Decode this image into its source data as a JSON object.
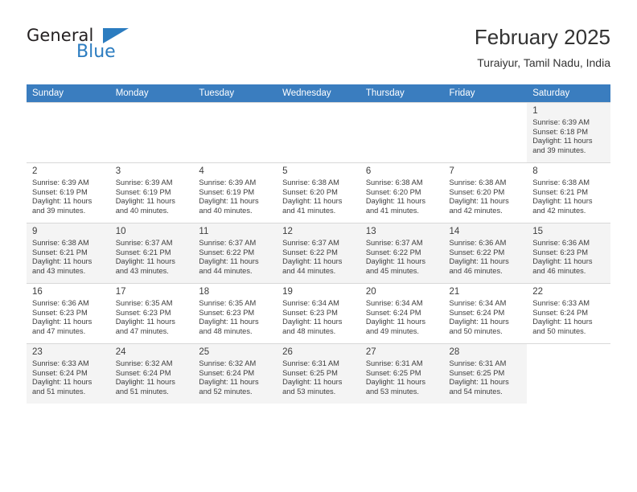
{
  "brand": {
    "name_top": "General",
    "name_bottom": "Blue",
    "accent_color": "#2b7cc0"
  },
  "header": {
    "month_year": "February 2025",
    "location": "Turaiyur, Tamil Nadu, India"
  },
  "calendar": {
    "header_bg": "#3a7dbf",
    "day_names": [
      "Sunday",
      "Monday",
      "Tuesday",
      "Wednesday",
      "Thursday",
      "Friday",
      "Saturday"
    ],
    "weeks": [
      [
        {
          "empty": true
        },
        {
          "empty": true
        },
        {
          "empty": true
        },
        {
          "empty": true
        },
        {
          "empty": true
        },
        {
          "empty": true
        },
        {
          "day": "1",
          "sunrise": "Sunrise: 6:39 AM",
          "sunset": "Sunset: 6:18 PM",
          "daylight_line1": "Daylight: 11 hours",
          "daylight_line2": "and 39 minutes."
        }
      ],
      [
        {
          "day": "2",
          "sunrise": "Sunrise: 6:39 AM",
          "sunset": "Sunset: 6:19 PM",
          "daylight_line1": "Daylight: 11 hours",
          "daylight_line2": "and 39 minutes."
        },
        {
          "day": "3",
          "sunrise": "Sunrise: 6:39 AM",
          "sunset": "Sunset: 6:19 PM",
          "daylight_line1": "Daylight: 11 hours",
          "daylight_line2": "and 40 minutes."
        },
        {
          "day": "4",
          "sunrise": "Sunrise: 6:39 AM",
          "sunset": "Sunset: 6:19 PM",
          "daylight_line1": "Daylight: 11 hours",
          "daylight_line2": "and 40 minutes."
        },
        {
          "day": "5",
          "sunrise": "Sunrise: 6:38 AM",
          "sunset": "Sunset: 6:20 PM",
          "daylight_line1": "Daylight: 11 hours",
          "daylight_line2": "and 41 minutes."
        },
        {
          "day": "6",
          "sunrise": "Sunrise: 6:38 AM",
          "sunset": "Sunset: 6:20 PM",
          "daylight_line1": "Daylight: 11 hours",
          "daylight_line2": "and 41 minutes."
        },
        {
          "day": "7",
          "sunrise": "Sunrise: 6:38 AM",
          "sunset": "Sunset: 6:20 PM",
          "daylight_line1": "Daylight: 11 hours",
          "daylight_line2": "and 42 minutes."
        },
        {
          "day": "8",
          "sunrise": "Sunrise: 6:38 AM",
          "sunset": "Sunset: 6:21 PM",
          "daylight_line1": "Daylight: 11 hours",
          "daylight_line2": "and 42 minutes."
        }
      ],
      [
        {
          "day": "9",
          "sunrise": "Sunrise: 6:38 AM",
          "sunset": "Sunset: 6:21 PM",
          "daylight_line1": "Daylight: 11 hours",
          "daylight_line2": "and 43 minutes."
        },
        {
          "day": "10",
          "sunrise": "Sunrise: 6:37 AM",
          "sunset": "Sunset: 6:21 PM",
          "daylight_line1": "Daylight: 11 hours",
          "daylight_line2": "and 43 minutes."
        },
        {
          "day": "11",
          "sunrise": "Sunrise: 6:37 AM",
          "sunset": "Sunset: 6:22 PM",
          "daylight_line1": "Daylight: 11 hours",
          "daylight_line2": "and 44 minutes."
        },
        {
          "day": "12",
          "sunrise": "Sunrise: 6:37 AM",
          "sunset": "Sunset: 6:22 PM",
          "daylight_line1": "Daylight: 11 hours",
          "daylight_line2": "and 44 minutes."
        },
        {
          "day": "13",
          "sunrise": "Sunrise: 6:37 AM",
          "sunset": "Sunset: 6:22 PM",
          "daylight_line1": "Daylight: 11 hours",
          "daylight_line2": "and 45 minutes."
        },
        {
          "day": "14",
          "sunrise": "Sunrise: 6:36 AM",
          "sunset": "Sunset: 6:22 PM",
          "daylight_line1": "Daylight: 11 hours",
          "daylight_line2": "and 46 minutes."
        },
        {
          "day": "15",
          "sunrise": "Sunrise: 6:36 AM",
          "sunset": "Sunset: 6:23 PM",
          "daylight_line1": "Daylight: 11 hours",
          "daylight_line2": "and 46 minutes."
        }
      ],
      [
        {
          "day": "16",
          "sunrise": "Sunrise: 6:36 AM",
          "sunset": "Sunset: 6:23 PM",
          "daylight_line1": "Daylight: 11 hours",
          "daylight_line2": "and 47 minutes."
        },
        {
          "day": "17",
          "sunrise": "Sunrise: 6:35 AM",
          "sunset": "Sunset: 6:23 PM",
          "daylight_line1": "Daylight: 11 hours",
          "daylight_line2": "and 47 minutes."
        },
        {
          "day": "18",
          "sunrise": "Sunrise: 6:35 AM",
          "sunset": "Sunset: 6:23 PM",
          "daylight_line1": "Daylight: 11 hours",
          "daylight_line2": "and 48 minutes."
        },
        {
          "day": "19",
          "sunrise": "Sunrise: 6:34 AM",
          "sunset": "Sunset: 6:23 PM",
          "daylight_line1": "Daylight: 11 hours",
          "daylight_line2": "and 48 minutes."
        },
        {
          "day": "20",
          "sunrise": "Sunrise: 6:34 AM",
          "sunset": "Sunset: 6:24 PM",
          "daylight_line1": "Daylight: 11 hours",
          "daylight_line2": "and 49 minutes."
        },
        {
          "day": "21",
          "sunrise": "Sunrise: 6:34 AM",
          "sunset": "Sunset: 6:24 PM",
          "daylight_line1": "Daylight: 11 hours",
          "daylight_line2": "and 50 minutes."
        },
        {
          "day": "22",
          "sunrise": "Sunrise: 6:33 AM",
          "sunset": "Sunset: 6:24 PM",
          "daylight_line1": "Daylight: 11 hours",
          "daylight_line2": "and 50 minutes."
        }
      ],
      [
        {
          "day": "23",
          "sunrise": "Sunrise: 6:33 AM",
          "sunset": "Sunset: 6:24 PM",
          "daylight_line1": "Daylight: 11 hours",
          "daylight_line2": "and 51 minutes."
        },
        {
          "day": "24",
          "sunrise": "Sunrise: 6:32 AM",
          "sunset": "Sunset: 6:24 PM",
          "daylight_line1": "Daylight: 11 hours",
          "daylight_line2": "and 51 minutes."
        },
        {
          "day": "25",
          "sunrise": "Sunrise: 6:32 AM",
          "sunset": "Sunset: 6:24 PM",
          "daylight_line1": "Daylight: 11 hours",
          "daylight_line2": "and 52 minutes."
        },
        {
          "day": "26",
          "sunrise": "Sunrise: 6:31 AM",
          "sunset": "Sunset: 6:25 PM",
          "daylight_line1": "Daylight: 11 hours",
          "daylight_line2": "and 53 minutes."
        },
        {
          "day": "27",
          "sunrise": "Sunrise: 6:31 AM",
          "sunset": "Sunset: 6:25 PM",
          "daylight_line1": "Daylight: 11 hours",
          "daylight_line2": "and 53 minutes."
        },
        {
          "day": "28",
          "sunrise": "Sunrise: 6:31 AM",
          "sunset": "Sunset: 6:25 PM",
          "daylight_line1": "Daylight: 11 hours",
          "daylight_line2": "and 54 minutes."
        },
        {
          "empty": true
        }
      ]
    ]
  }
}
